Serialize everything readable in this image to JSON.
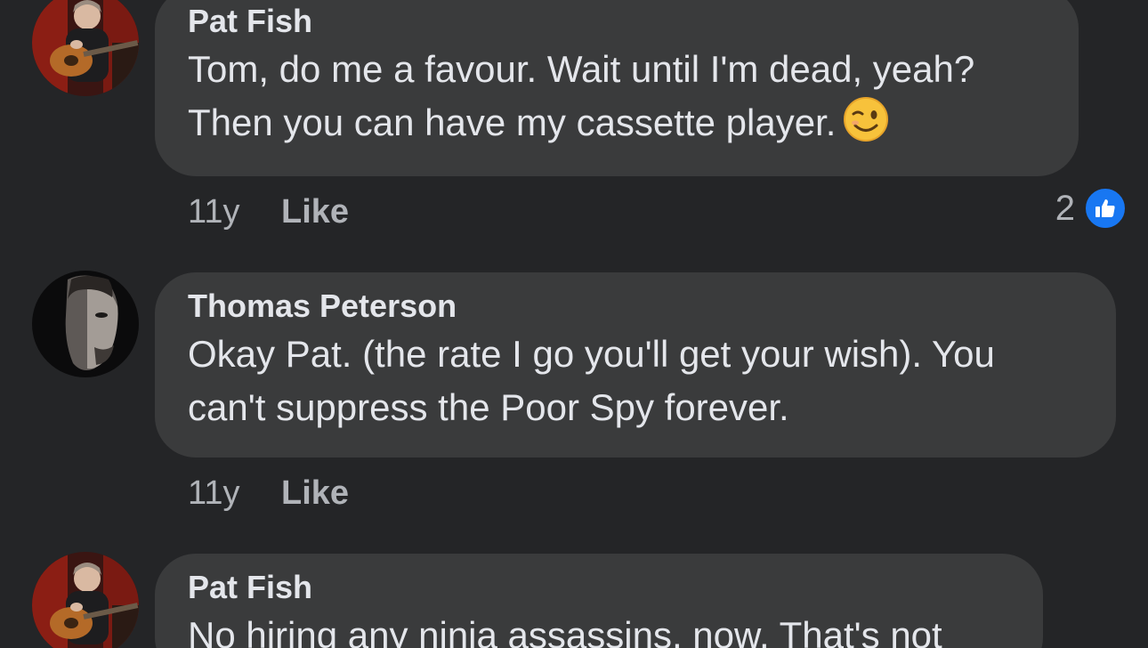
{
  "comments": [
    {
      "author": "Pat Fish",
      "text": "Tom, do me a favour. Wait until I'm dead, yeah? Then you can have my cassette player.",
      "emoji": "winking-face",
      "time": "11y",
      "like_label": "Like",
      "reaction_count": "2",
      "reaction_icon": "like-thumb-icon",
      "avatar": "pat-fish-guitar-avatar"
    },
    {
      "author": "Thomas Peterson",
      "text": "Okay Pat.  (the rate I go you'll get your wish). You can't suppress the Poor Spy forever.",
      "time": "11y",
      "like_label": "Like",
      "avatar": "thomas-peterson-portrait-avatar"
    },
    {
      "author": "Pat Fish",
      "text": "No hiring any ninja assassins, now. That's not",
      "avatar": "pat-fish-guitar-avatar"
    }
  ],
  "colors": {
    "background": "#242527",
    "bubble": "#3a3b3c",
    "primary_text": "#e4e6eb",
    "secondary_text": "#b0b3b8",
    "like_blue": "#1877f2"
  }
}
